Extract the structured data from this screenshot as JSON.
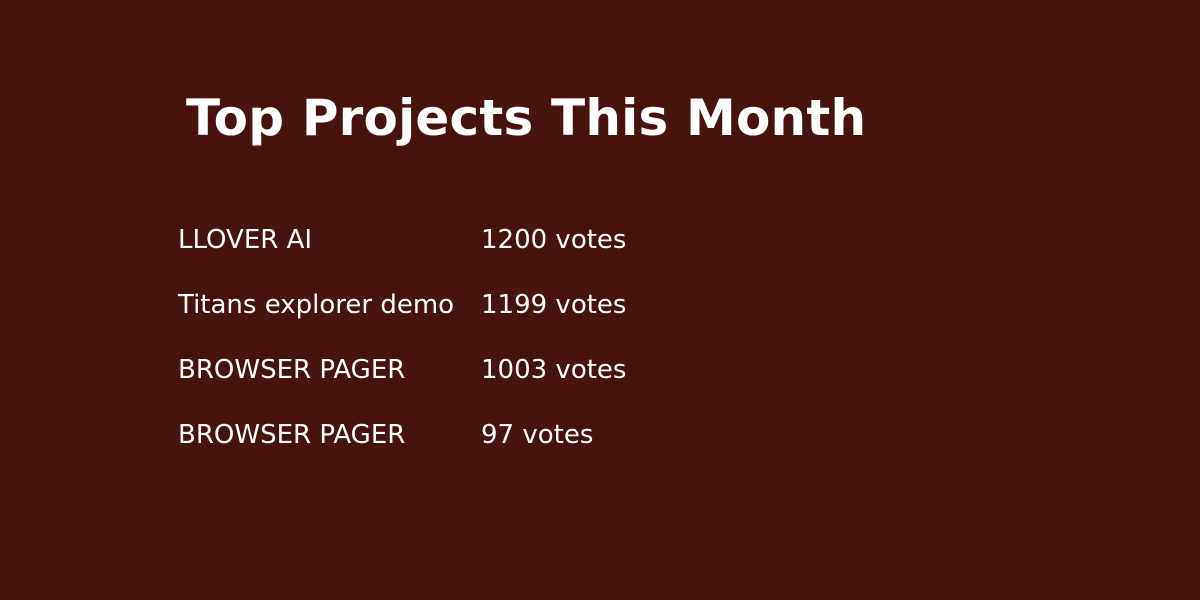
{
  "page": {
    "background": "#48120e",
    "text_color": "#ffffff"
  },
  "header": {
    "title": "Top Projects This Month"
  },
  "projects": [
    {
      "name": "LLOVER AI",
      "votes": "1200 votes"
    },
    {
      "name": "Titans explorer demo",
      "votes": "1199 votes"
    },
    {
      "name": "BROWSER PAGER",
      "votes": "1003 votes"
    },
    {
      "name": "BROWSER PAGER",
      "votes": "97 votes"
    }
  ]
}
